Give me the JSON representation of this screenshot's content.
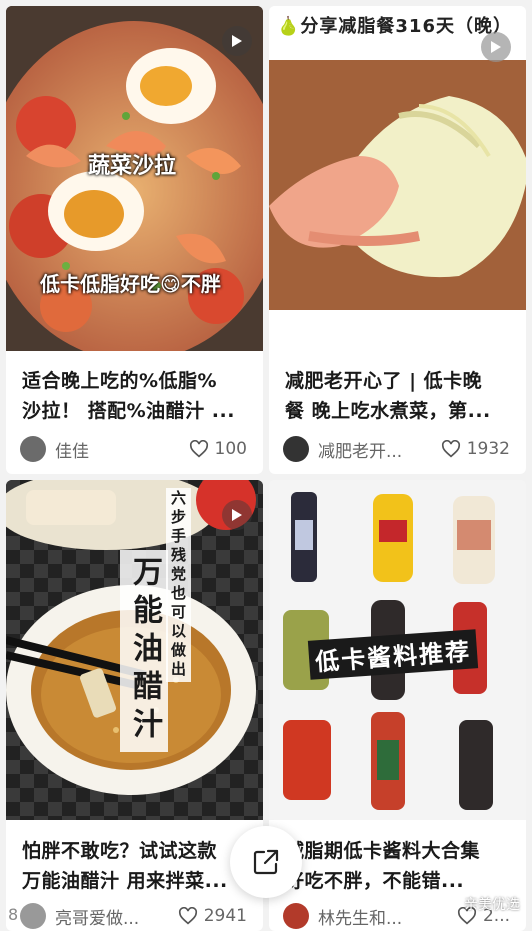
{
  "cards": [
    {
      "overlay_title": "蔬菜沙拉",
      "overlay_caption": "低卡低脂好吃😋不胖",
      "title": "适合晚上吃的%低脂%\n沙拉！ 搭配%油醋汁 ...",
      "author": "佳佳",
      "likes": "100"
    },
    {
      "overlay_title": "🍐分享减脂餐316天（晚）",
      "title": "减肥老开心了 | 低卡晚\n餐 晚上吃水煮菜，第...",
      "author": "减肥老开...",
      "likes": "1932"
    },
    {
      "overlay_title": "万能油醋汁",
      "overlay_caption": "六步手残党也可以做出",
      "title": "怕胖不敢吃？试试这款\n万能油醋汁 用来拌菜...",
      "author": "亮哥爱做...",
      "likes": "2941"
    },
    {
      "overlay_title": "低卡酱料推荐",
      "title": "减脂期低卡酱料大合集\n好吃不胖，不能错...",
      "author": "林先生和...",
      "likes": "2..."
    }
  ],
  "watermark": "亲美优选",
  "watermark_left": "8"
}
